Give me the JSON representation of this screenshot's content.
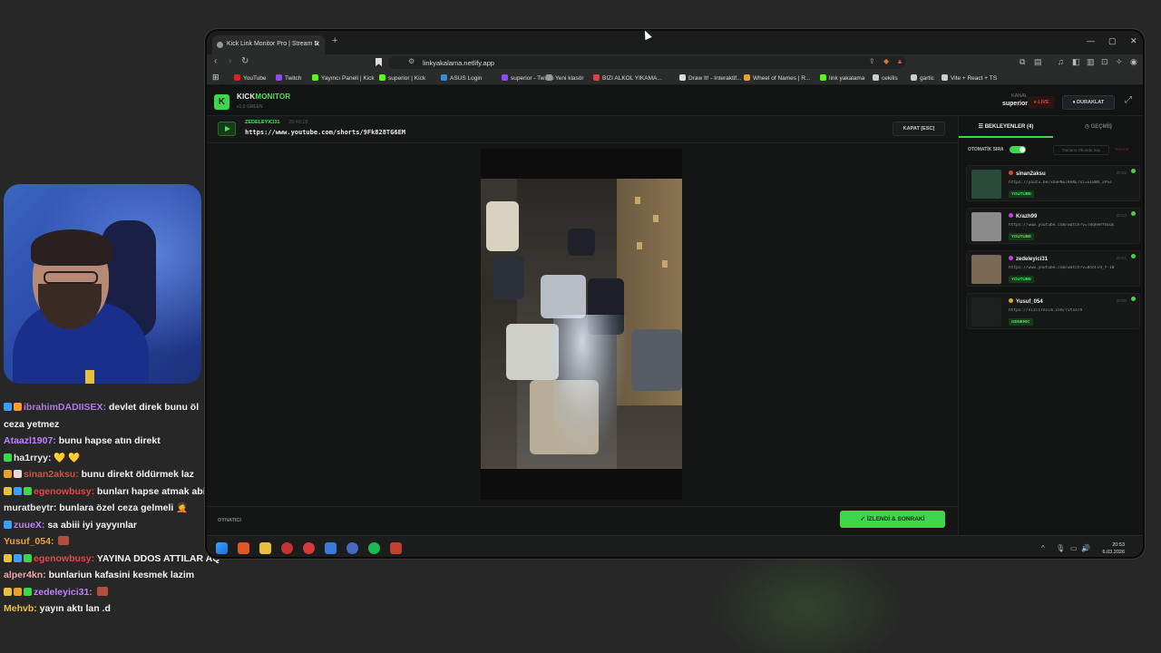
{
  "browser": {
    "tab_title": "Kick Link Monitor Pro | Stream D",
    "url": "linkyakalama.netlify.app",
    "bookmarks": [
      {
        "label": "YouTube",
        "color": "#e02020"
      },
      {
        "label": "Twitch",
        "color": "#9146ff"
      },
      {
        "label": "Yayıncı Paneli | Kick",
        "color": "#53fc18"
      },
      {
        "label": "superior | Kick",
        "color": "#53fc18"
      },
      {
        "label": "ASUS Login",
        "color": "#3a8ad8"
      },
      {
        "label": "superior - Twitch",
        "color": "#9146ff"
      },
      {
        "label": "Yeni klasör",
        "color": "#999999"
      },
      {
        "label": "BIZI ALKOL YIKAMA...",
        "color": "#e04040"
      },
      {
        "label": "Draw It! - Interaktif...",
        "color": "#dddddd"
      },
      {
        "label": "Wheel of Names | R...",
        "color": "#e8a030"
      },
      {
        "label": "link yakalama",
        "color": "#53fc18"
      },
      {
        "label": "cekilis",
        "color": "#cccccc"
      },
      {
        "label": "gartic",
        "color": "#cccccc"
      },
      {
        "label": "Vite + React + TS",
        "color": "#cccccc"
      }
    ]
  },
  "app": {
    "brand_a": "KICK",
    "brand_b": "MONITOR",
    "logo_letter": "K",
    "version": "v1.0 GREEN",
    "kanal_label": "KANAL",
    "kanal_value": "superior",
    "live_label": "● LIVE",
    "pause_label": "⏸ DURAKLAT",
    "current": {
      "user": "ZEDELEYICI31",
      "time": "20:49:18",
      "url": "https://www.youtube.com/shorts/9Fk828TG6EM"
    },
    "close_label": "KAPAT [ESC]",
    "player_label": "OYNATICI",
    "next_label": "İZLENDİ & SONRAKİ",
    "accent": "#3ed64a"
  },
  "sidebar": {
    "tab_waiting": "BEKLEYENLER (4)",
    "tab_history": "GEÇMİŞ",
    "auto_order": "OTOMATİK SIRA",
    "mark_all": "Tümünü Okundu Say",
    "clear": "Temizle",
    "queue": [
      {
        "user": "sinan2aksu",
        "dot": "#e04040",
        "time": "20:52",
        "url": "https://youtu.be/xOuPNuTKkKE?si=vIB8R_2PSs",
        "badge": "YOUTUBE",
        "thumb": "#2a4a3a"
      },
      {
        "user": "Krazh99",
        "dot": "#c040e0",
        "time": "20:53",
        "url": "https://www.youtube.com/watch?v=T8qheRfoEQs",
        "badge": "YOUTUBE",
        "thumb": "#8a8a8a"
      },
      {
        "user": "zedeleyici31",
        "dot": "#c040e0",
        "time": "20:51",
        "url": "https://www.youtube.com/watch?v=05oFI9_Y-10",
        "badge": "YOUTUBE",
        "thumb": "#7a6a55"
      },
      {
        "user": "Yusuf_054",
        "dot": "#e8a030",
        "time": "20:50",
        "url": "https://nizliresim.com/rvtso7h",
        "badge": "GENERIC",
        "thumb": "#1e201f"
      }
    ]
  },
  "taskbar": {
    "time": "20:53",
    "date": "6.03.2026"
  },
  "chat": [
    {
      "user": "ibrahimDADIISEX:",
      "color": "#b07ae0",
      "msg": "devlet direk bunu öl ceza yetmez",
      "badges": [
        "#3aa0ff",
        "#ff9a2a"
      ]
    },
    {
      "user": "Ataazl1907:",
      "color": "#c080ff",
      "msg": "bunu hapse atın direkt",
      "badges": []
    },
    {
      "user": "ha1rryy:",
      "color": "#e8e8e8",
      "msg": "💛 💛",
      "badges": [
        "#3ed64a"
      ]
    },
    {
      "user": "sinan2aksu:",
      "color": "#e04a4a",
      "msg": "bunu direkt öldürmek laz",
      "badges": [
        "#e8a030",
        "#dddddd"
      ]
    },
    {
      "user": "egenowbusy:",
      "color": "#e04a4a",
      "msg": "bunları hapse atmak abi",
      "badges": [
        "#e8c040",
        "#3aa0ff",
        "#3ed64a"
      ]
    },
    {
      "user": "muratbeytr:",
      "color": "#e8e8e8",
      "msg": "bunlara özel ceza gelmeli 🤦",
      "badges": []
    },
    {
      "user": "zuueX:",
      "color": "#c080ff",
      "msg": "sa abiii iyi yayyınlar",
      "badges": [
        "#3aa0ff"
      ]
    },
    {
      "user": "Yusuf_054:",
      "color": "#f0a040",
      "msg": "",
      "badges": []
    },
    {
      "user": "egenowbusy:",
      "color": "#e04a4a",
      "msg": "YAYINA DDOS ATTILAR AQ",
      "badges": [
        "#e8c040",
        "#3aa0ff",
        "#3ed64a"
      ]
    },
    {
      "user": "alper4kn:",
      "color": "#e8a8a8",
      "msg": "bunlariun kafasini kesmek lazim",
      "badges": []
    },
    {
      "user": "zedeleyici31:",
      "color": "#c080ff",
      "msg": "",
      "badges": [
        "#e8c040",
        "#e8a030",
        "#3ed64a"
      ]
    },
    {
      "user": "Mehvb:",
      "color": "#f0c040",
      "msg": "yayın aktı lan .d",
      "badges": []
    }
  ]
}
